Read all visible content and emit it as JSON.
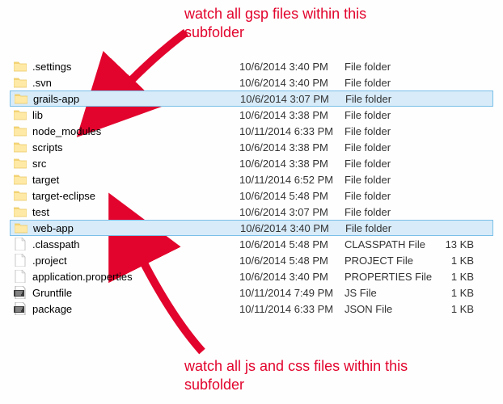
{
  "annotations": {
    "top": "watch all gsp files within this subfolder",
    "bottom": "watch all js and css files within this subfolder"
  },
  "files": [
    {
      "name": ".settings",
      "date": "10/6/2014 3:40 PM",
      "type": "File folder",
      "size": "",
      "icon": "folder",
      "selected": false
    },
    {
      "name": ".svn",
      "date": "10/6/2014 3:40 PM",
      "type": "File folder",
      "size": "",
      "icon": "folder",
      "selected": false
    },
    {
      "name": "grails-app",
      "date": "10/6/2014 3:07 PM",
      "type": "File folder",
      "size": "",
      "icon": "folder",
      "selected": true
    },
    {
      "name": "lib",
      "date": "10/6/2014 3:38 PM",
      "type": "File folder",
      "size": "",
      "icon": "folder",
      "selected": false
    },
    {
      "name": "node_modules",
      "date": "10/11/2014 6:33 PM",
      "type": "File folder",
      "size": "",
      "icon": "folder",
      "selected": false
    },
    {
      "name": "scripts",
      "date": "10/6/2014 3:38 PM",
      "type": "File folder",
      "size": "",
      "icon": "folder",
      "selected": false
    },
    {
      "name": "src",
      "date": "10/6/2014 3:38 PM",
      "type": "File folder",
      "size": "",
      "icon": "folder",
      "selected": false
    },
    {
      "name": "target",
      "date": "10/11/2014 6:52 PM",
      "type": "File folder",
      "size": "",
      "icon": "folder",
      "selected": false
    },
    {
      "name": "target-eclipse",
      "date": "10/6/2014 5:48 PM",
      "type": "File folder",
      "size": "",
      "icon": "folder",
      "selected": false
    },
    {
      "name": "test",
      "date": "10/6/2014 3:07 PM",
      "type": "File folder",
      "size": "",
      "icon": "folder",
      "selected": false
    },
    {
      "name": "web-app",
      "date": "10/6/2014 3:40 PM",
      "type": "File folder",
      "size": "",
      "icon": "folder",
      "selected": true
    },
    {
      "name": ".classpath",
      "date": "10/6/2014 5:48 PM",
      "type": "CLASSPATH File",
      "size": "13 KB",
      "icon": "file",
      "selected": false
    },
    {
      "name": ".project",
      "date": "10/6/2014 5:48 PM",
      "type": "PROJECT File",
      "size": "1 KB",
      "icon": "file",
      "selected": false
    },
    {
      "name": "application.properties",
      "date": "10/6/2014 3:40 PM",
      "type": "PROPERTIES File",
      "size": "1 KB",
      "icon": "file",
      "selected": false
    },
    {
      "name": "Gruntfile",
      "date": "10/11/2014 7:49 PM",
      "type": "JS File",
      "size": "1 KB",
      "icon": "js",
      "selected": false
    },
    {
      "name": "package",
      "date": "10/11/2014 6:33 PM",
      "type": "JSON File",
      "size": "1 KB",
      "icon": "js",
      "selected": false
    }
  ],
  "colors": {
    "annotation": "#e2042d",
    "selection_bg": "#d7ebf9",
    "selection_border": "#7abfe8"
  }
}
